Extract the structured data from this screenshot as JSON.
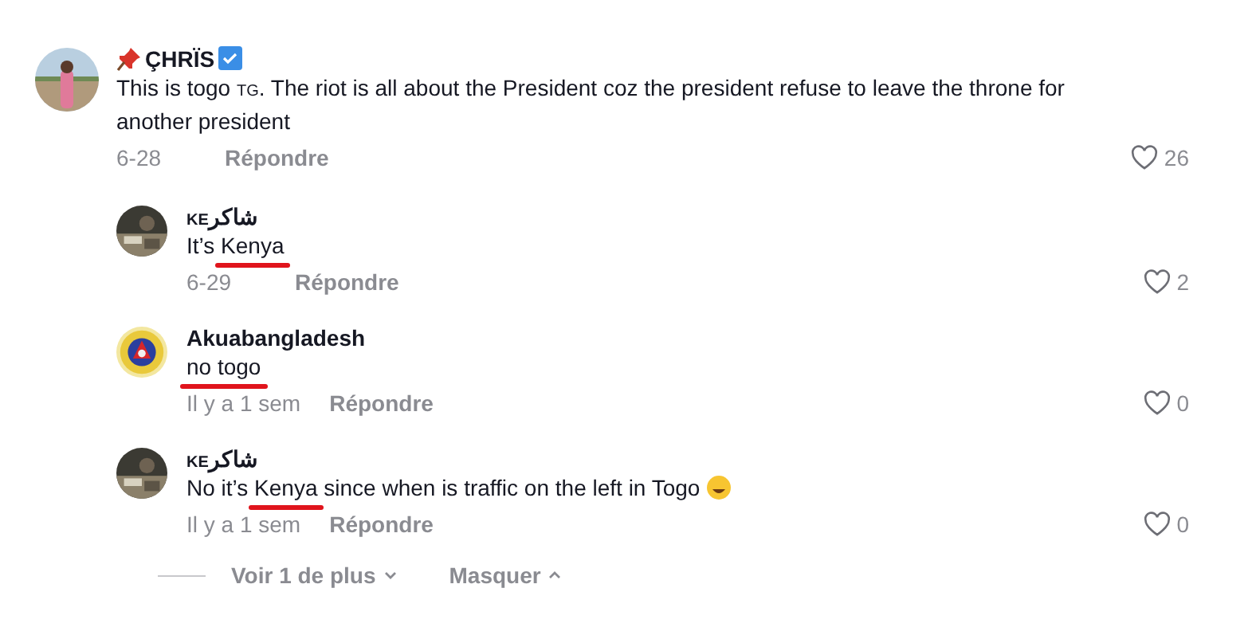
{
  "comments": [
    {
      "name_parts": [
        {
          "text": "ÇHRÏS",
          "kind": "plain"
        }
      ],
      "pinned": true,
      "verified": true,
      "text_parts": [
        {
          "text": "This is togo ",
          "kind": "plain"
        },
        {
          "text": "TG",
          "kind": "small"
        },
        {
          "text": ". The riot is all about the President coz the president refuse to leave the throne for another president",
          "kind": "plain"
        }
      ],
      "date": "6-28",
      "reply": "Répondre",
      "likes": "26",
      "replies": [
        {
          "name_parts": [
            {
              "text": "KE",
              "kind": "small"
            },
            {
              "text": "شاكر",
              "kind": "plain"
            }
          ],
          "text_parts": [
            {
              "text": "It’s ",
              "kind": "plain"
            },
            {
              "text": "Kenya",
              "kind": "marked"
            }
          ],
          "date": "6-29",
          "reply": "Répondre",
          "likes": "2"
        },
        {
          "name_parts": [
            {
              "text": "Akuabangladesh",
              "kind": "plain"
            }
          ],
          "text_parts": [
            {
              "text": "no togo",
              "kind": "marked"
            }
          ],
          "date": "Il y a 1 sem",
          "reply": "Répondre",
          "likes": "0"
        },
        {
          "name_parts": [
            {
              "text": "KE",
              "kind": "small"
            },
            {
              "text": "شاكر",
              "kind": "plain"
            }
          ],
          "text_parts": [
            {
              "text": "No it’s ",
              "kind": "plain"
            },
            {
              "text": "Kenya",
              "kind": "marked"
            },
            {
              "text": " since when is traffic on the left in Togo ",
              "kind": "plain"
            }
          ],
          "emoji": true,
          "date": "Il y a 1 sem",
          "reply": "Répondre",
          "likes": "0"
        }
      ]
    }
  ],
  "footer": {
    "more": "Voir 1 de plus",
    "hide": "Masquer"
  }
}
